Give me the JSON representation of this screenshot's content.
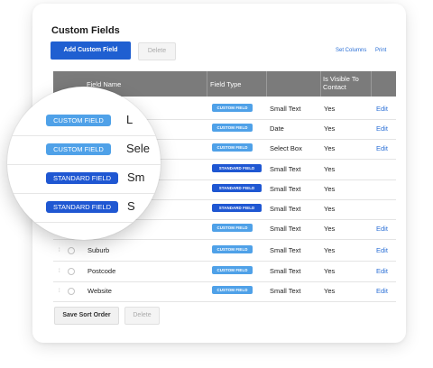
{
  "page": {
    "title": "Custom Fields",
    "add_button": "Add Custom Field",
    "delete_button": "Delete",
    "set_columns": "Set Columns",
    "print": "Print",
    "save_sort_order": "Save Sort Order",
    "bottom_delete": "Delete"
  },
  "table": {
    "headers": {
      "field_name": "Field Name",
      "field_type": "Field Type",
      "visible": "Is Visible To Contact"
    },
    "rows": [
      {
        "name": "",
        "badge": "CUSTOM FIELD",
        "badge_kind": "custom",
        "type": "Small Text",
        "visible": "Yes",
        "edit": "Edit"
      },
      {
        "name": "",
        "badge": "CUSTOM FIELD",
        "badge_kind": "custom",
        "type": "Date",
        "visible": "Yes",
        "edit": "Edit"
      },
      {
        "name": "",
        "badge": "CUSTOM FIELD",
        "badge_kind": "custom",
        "type": "Select Box",
        "visible": "Yes",
        "edit": "Edit"
      },
      {
        "name": "",
        "badge": "STANDARD FIELD",
        "badge_kind": "standard",
        "type": "Small Text",
        "visible": "Yes",
        "edit": ""
      },
      {
        "name": "",
        "badge": "STANDARD FIELD",
        "badge_kind": "standard",
        "type": "Small Text",
        "visible": "Yes",
        "edit": ""
      },
      {
        "name": "",
        "badge": "STANDARD FIELD",
        "badge_kind": "standard",
        "type": "Small Text",
        "visible": "Yes",
        "edit": ""
      },
      {
        "name": "",
        "badge": "CUSTOM FIELD",
        "badge_kind": "custom",
        "type": "Small Text",
        "visible": "Yes",
        "edit": "Edit"
      },
      {
        "name": "Suburb",
        "badge": "CUSTOM FIELD",
        "badge_kind": "custom",
        "type": "Small Text",
        "visible": "Yes",
        "edit": "Edit"
      },
      {
        "name": "Postcode",
        "badge": "CUSTOM FIELD",
        "badge_kind": "custom",
        "type": "Small Text",
        "visible": "Yes",
        "edit": "Edit"
      },
      {
        "name": "Website",
        "badge": "CUSTOM FIELD",
        "badge_kind": "custom",
        "type": "Small Text",
        "visible": "Yes",
        "edit": "Edit"
      }
    ]
  },
  "magnifier": {
    "rows": [
      {
        "badge": "CUSTOM FIELD",
        "badge_kind": "custom",
        "text": "L"
      },
      {
        "badge": "CUSTOM FIELD",
        "badge_kind": "custom",
        "text": "Sele"
      },
      {
        "badge": "STANDARD FIELD",
        "badge_kind": "standard",
        "text": "Sm"
      },
      {
        "badge": "STANDARD FIELD",
        "badge_kind": "standard",
        "text": "S"
      }
    ]
  },
  "colors": {
    "accent": "#1f5fd1",
    "custom_badge": "#4fa1e8",
    "standard_badge": "#1f57d2",
    "header_bg": "#7b7b7b",
    "link": "#2a6fd6"
  },
  "icons": {
    "handle": "drag-handle-icon",
    "radio": "radio-select-icon"
  }
}
